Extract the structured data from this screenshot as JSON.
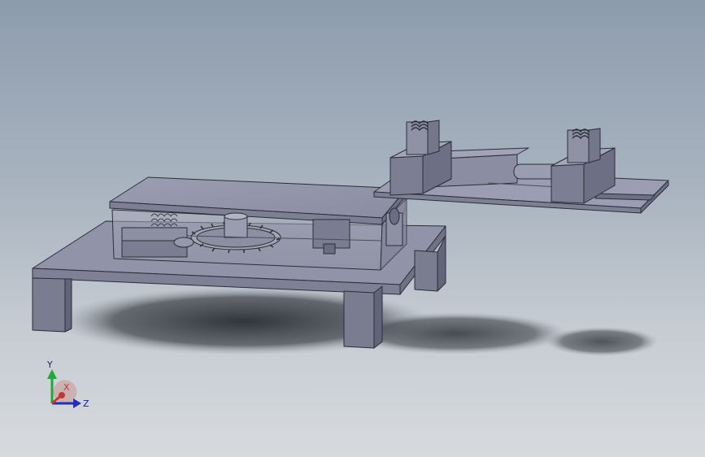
{
  "viewport": {
    "background_top": "#8d9cad",
    "background_bottom": "#d7dadd",
    "model_color": "#8a8ea2"
  },
  "triad": {
    "y_label": "Y",
    "x_label": "X",
    "z_label": "Z",
    "y_color": "#21a83a",
    "x_color": "#c73535",
    "z_color": "#2430b0"
  }
}
